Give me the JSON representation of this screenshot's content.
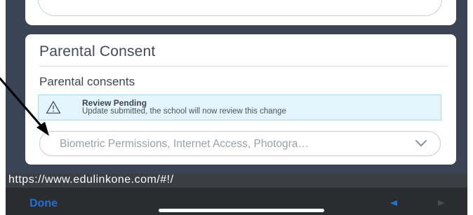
{
  "card": {
    "title": "Parental Consent",
    "section_label": "Parental consents",
    "alert": {
      "title": "Review Pending",
      "message": "Update submitted, the school will now review this change"
    },
    "select_value": "Biometric Permissions, Internet Access, Photogra…"
  },
  "browser": {
    "url": "https://www.edulinkone.com/#!/",
    "done_label": "Done"
  },
  "colors": {
    "accent": "#1e73d6",
    "alert_bg": "#e4f4fb",
    "alert_border": "#a9d9ee",
    "page_bg": "#3a4454"
  },
  "icons": {
    "alert": "warning-triangle-icon",
    "select": "chevron-down-icon",
    "nav_prev": "back-arrow-icon",
    "nav_next": "forward-arrow-icon"
  }
}
